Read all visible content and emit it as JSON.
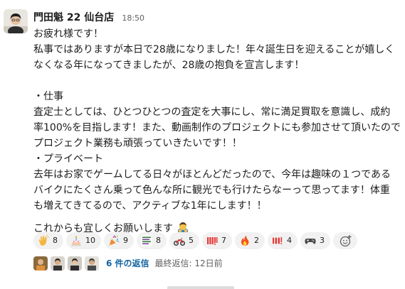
{
  "message": {
    "author": "門田魁 22 仙台店",
    "time": "18:50",
    "lines": [
      "お疲れ様です！",
      "私事ではありますが本日で28歳になりました！年々誕生日を迎えることが嬉しく",
      "なくなる年になってきましたが、28歳の抱負を宣言します！",
      "・仕事",
      "査定士としては、ひとつひとつの査定を大事にし、常に満足買取を意識し、成約",
      "率100%を目指します！また、動画制作のプロジェクトにも参加させて頂いたので",
      "プロジェクト業務も頑張っていきたいです！！",
      "・プライベート",
      "去年はお家でゲームしてる日々がほとんどだったので、今年は趣味の１つである",
      "バイクにたくさん乗って色んな所に観光でも行けたらなーって思ってます！体重",
      "も増えてきてるので、アクティブな1年にします！！",
      "これからも宜しくお願いします"
    ]
  },
  "reactions": [
    {
      "icon": "clap-icon",
      "count": "8"
    },
    {
      "icon": "cake-icon",
      "count": "10"
    },
    {
      "icon": "party-popper-icon",
      "count": "9"
    },
    {
      "icon": "custom-text-stamp-icon",
      "count": "8"
    },
    {
      "icon": "motorcycle-icon",
      "count": "5"
    },
    {
      "icon": "custom-red-text-icon",
      "count": "7"
    },
    {
      "icon": "fire-icon",
      "count": "2"
    },
    {
      "icon": "custom-red-text-icon-2",
      "count": "4"
    },
    {
      "icon": "game-controller-icon",
      "count": "3"
    }
  ],
  "thread": {
    "replies": "6 件の返信",
    "last_reply": "最終返信: 12日前"
  },
  "colors": {
    "link": "#1264a3",
    "reaction_bg": "#f1f1f1",
    "text": "#1d1c1d",
    "muted": "#616061"
  }
}
